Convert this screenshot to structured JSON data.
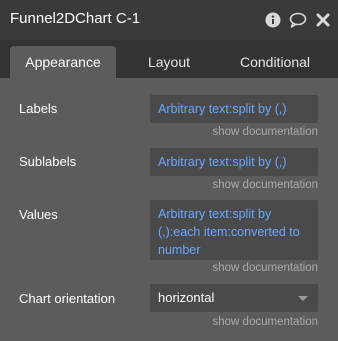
{
  "window": {
    "title": "Funnel2DChart C-1",
    "icons": [
      "info-icon",
      "comment-icon",
      "close-icon"
    ]
  },
  "tabs": [
    {
      "label": "Appearance",
      "active": true
    },
    {
      "label": "Layout",
      "active": false
    },
    {
      "label": "Conditional",
      "active": false
    }
  ],
  "properties": {
    "labels": {
      "label": "Labels",
      "value": "Arbitrary text:split by (,)",
      "doc": "show documentation"
    },
    "sublabels": {
      "label": "Sublabels",
      "value": "Arbitrary text:split by (,)",
      "doc": "show documentation"
    },
    "values": {
      "label": "Values",
      "value": "Arbitrary text:split by (,):each item:converted to number",
      "doc": "show documentation"
    },
    "orientation": {
      "label": "Chart orientation",
      "value": "horizontal",
      "doc": "show documentation"
    }
  },
  "colors": {
    "accent_text": "#6aa6ff",
    "panel_bg": "#5c5c5c",
    "titlebar_bg": "#3a3a3a"
  }
}
